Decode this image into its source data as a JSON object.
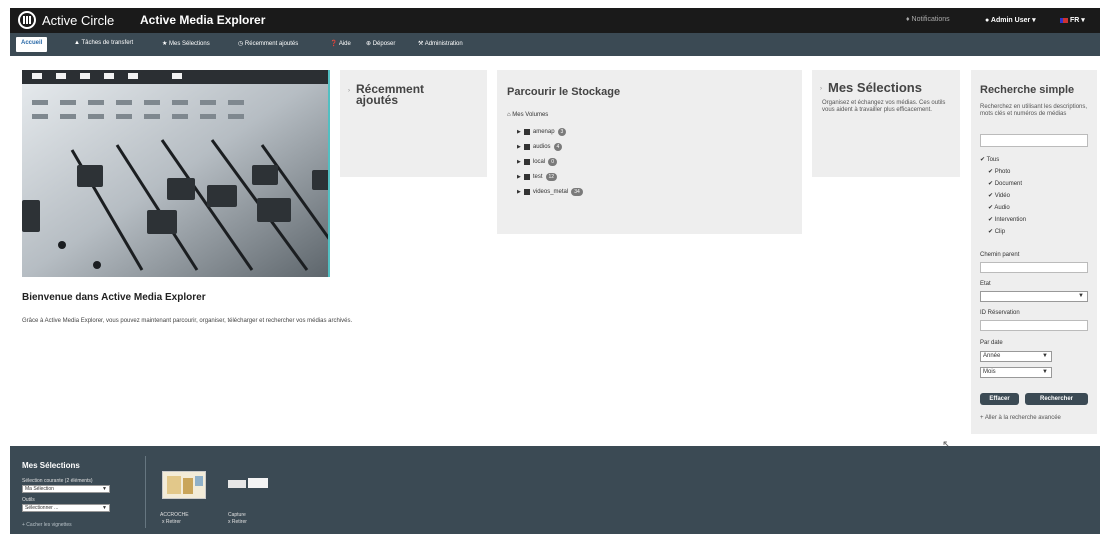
{
  "header": {
    "brand": "Active Circle",
    "app_title": "Active Media Explorer",
    "notifications": "♦ Notifications",
    "user": "Admin User ▾",
    "lang": "FR ▾"
  },
  "nav": {
    "items": [
      "Accueil",
      "Tâches de transfert",
      "Mes Sélections",
      "Récemment ajoutés",
      "Aide",
      "Déposer",
      "Administration"
    ]
  },
  "welcome": {
    "title": "Bienvenue dans Active Media Explorer",
    "text": "Grâce à Active Media Explorer, vous pouvez maintenant parcourir, organiser, télécharger et rechercher vos médias archivés."
  },
  "recent": {
    "title_line1": "Récemment",
    "title_line2": "ajoutés"
  },
  "storage": {
    "title": "Parcourir le Stockage",
    "root": "Mes Volumes",
    "volumes": [
      {
        "name": "amenap",
        "count": "3"
      },
      {
        "name": "audios",
        "count": "4"
      },
      {
        "name": "local",
        "count": "0"
      },
      {
        "name": "test",
        "count": "12"
      },
      {
        "name": "videos_metal",
        "count": "34"
      }
    ]
  },
  "selections": {
    "title": "Mes Sélections",
    "text": "Organisez et échangez vos médias. Ces outils vous aident à travailler plus efficacement."
  },
  "search": {
    "title": "Recherche simple",
    "help": "Recherchez en utilisant les descriptions, mots clés et numéros de médias",
    "all_label": "Tous",
    "types": [
      "Photo",
      "Document",
      "Vidéo",
      "Audio",
      "Intervention",
      "Clip"
    ],
    "parent_path_label": "Chemin parent",
    "state_label": "Etat",
    "reservation_label": "ID Réservation",
    "date_label": "Par date",
    "year_option": "Année",
    "month_option": "Mois",
    "clear_button": "Effacer",
    "search_button": "Rechercher",
    "advanced_link": "+ Aller à la recherche avancée"
  },
  "footer": {
    "title": "Mes Sélections",
    "current_label": "Sélection courante (2 éléments)",
    "current_value": "Ma Sélection",
    "tools_label": "Outils",
    "tools_value": "Sélectionner ...",
    "hide_link": "+ Cacher les vignettes",
    "item1_name": "ACCROCHE",
    "item1_action": "x Retirer",
    "item2_name": "Capture",
    "item2_action": "x Retirer"
  }
}
